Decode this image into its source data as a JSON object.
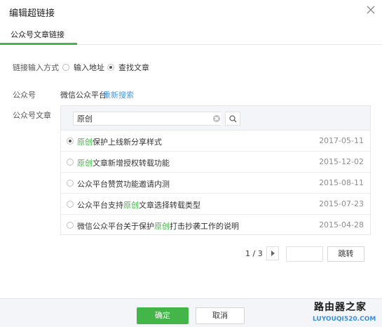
{
  "dialog": {
    "title": "编辑超链接"
  },
  "tabs": [
    {
      "label": "公众号文章链接"
    }
  ],
  "link_input": {
    "label": "链接输入方式",
    "options": [
      {
        "label": "输入地址",
        "checked": false
      },
      {
        "label": "查找文章",
        "checked": true
      }
    ]
  },
  "account": {
    "label": "公众号",
    "value": "微信公众平台",
    "research_link": "重新搜索"
  },
  "articles": {
    "label": "公众号文章",
    "search": {
      "value": "原创"
    },
    "items": [
      {
        "pre": "",
        "hl": "原创",
        "post": "保护上线新分享样式",
        "date": "2017-05-11",
        "selected": true
      },
      {
        "pre": "",
        "hl": "原创",
        "post": "文章新增授权转载功能",
        "date": "2015-12-02",
        "selected": false
      },
      {
        "pre": "公众平台赞赏功能邀请内测",
        "hl": "",
        "post": "",
        "date": "2015-08-11",
        "selected": false
      },
      {
        "pre": "公众平台支持",
        "hl": "原创",
        "post": "文章选择转载类型",
        "date": "2015-07-23",
        "selected": false
      },
      {
        "pre": "微信公众平台关于保护",
        "hl": "原创",
        "post": "打击抄袭工作的说明",
        "date": "2015-04-28",
        "selected": false
      }
    ]
  },
  "pagination": {
    "text": "1 / 3",
    "page_input": "",
    "jump_label": "跳转"
  },
  "footer": {
    "confirm_label": "确定",
    "cancel_label": "取消"
  },
  "watermark": {
    "cn": "路由器之家",
    "en": "LUYOUQI520.COM"
  },
  "colors": {
    "accent": "#44b549",
    "link": "#459ae9"
  }
}
